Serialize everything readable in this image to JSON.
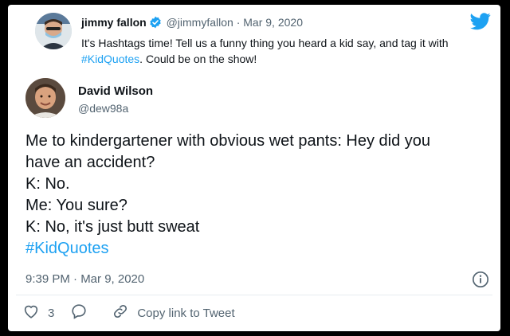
{
  "quoted": {
    "name": "jimmy fallon",
    "handle": "@jimmyfallon",
    "separator": "·",
    "date": "Mar 9, 2020",
    "text_before": "It's Hashtags time! Tell us a funny thing you heard a kid say, and tag it with ",
    "hashtag": "#KidQuotes",
    "text_after": ". Could be on the show!"
  },
  "tweet": {
    "author_name": "David Wilson",
    "author_handle": "@dew98a",
    "lines": [
      "Me to kindergartener with obvious wet pants: Hey did you",
      "have an accident?",
      "K: No.",
      "Me: You sure?",
      "K: No, it's just butt sweat"
    ],
    "hashtag": "#KidQuotes",
    "timestamp": "9:39 PM · Mar 9, 2020"
  },
  "actions": {
    "like_count": "3",
    "copy_link_label": "Copy link to Tweet"
  },
  "icons": {
    "brand": "twitter-bird-icon",
    "verified": "verified-badge-icon",
    "info": "info-icon",
    "like": "heart-icon",
    "reply": "reply-bubble-icon",
    "link": "link-icon"
  },
  "colors": {
    "accent": "#1da1f2",
    "text": "#0f1419",
    "muted": "#536471"
  }
}
